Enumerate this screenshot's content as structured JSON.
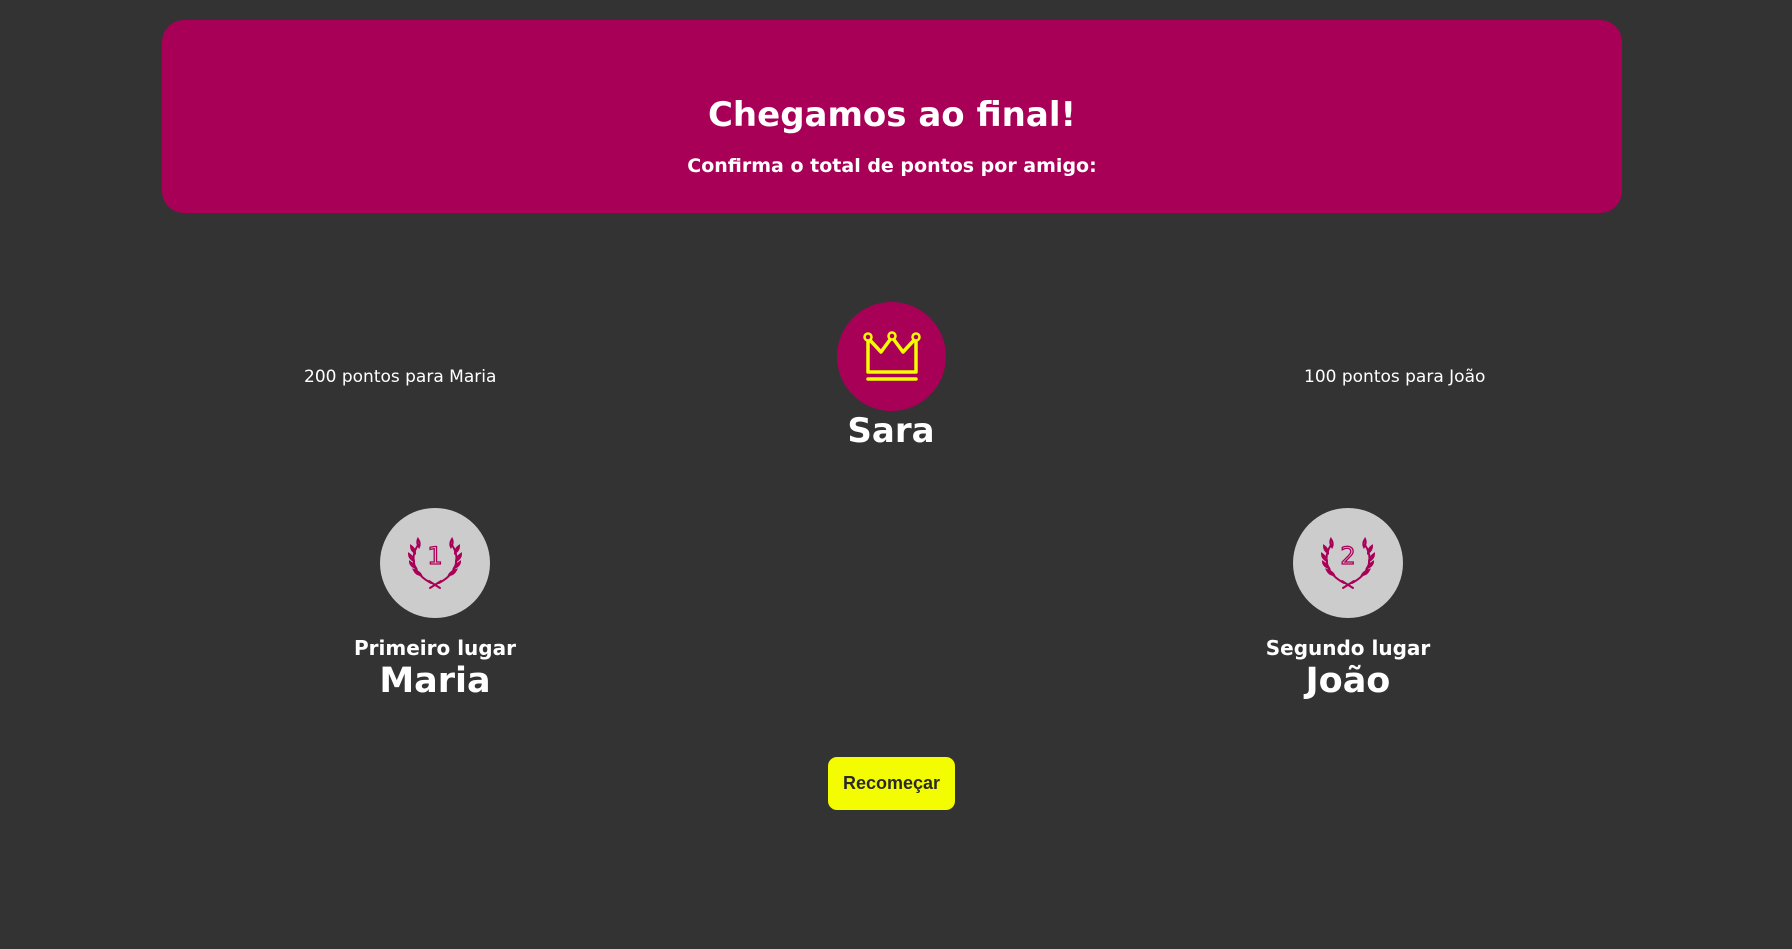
{
  "header": {
    "title": "Chegamos ao final!",
    "subtitle": "Confirma o total de pontos por amigo:"
  },
  "scores": {
    "left": "200 pontos para Maria",
    "right": "100 pontos para João"
  },
  "winner": {
    "name": "Sara",
    "icon": "crown-icon"
  },
  "places": [
    {
      "label": "Primeiro lugar",
      "name": "Maria",
      "number": "1",
      "icon": "laurel-medal-icon"
    },
    {
      "label": "Segundo lugar",
      "name": "João",
      "number": "2",
      "icon": "laurel-medal-icon"
    }
  ],
  "actions": {
    "restart_label": "Recomeçar"
  },
  "colors": {
    "background": "#333333",
    "accent": "#a90057",
    "button": "#f3fc00",
    "crown": "#f3fc00",
    "medal_background": "#cccccc"
  }
}
